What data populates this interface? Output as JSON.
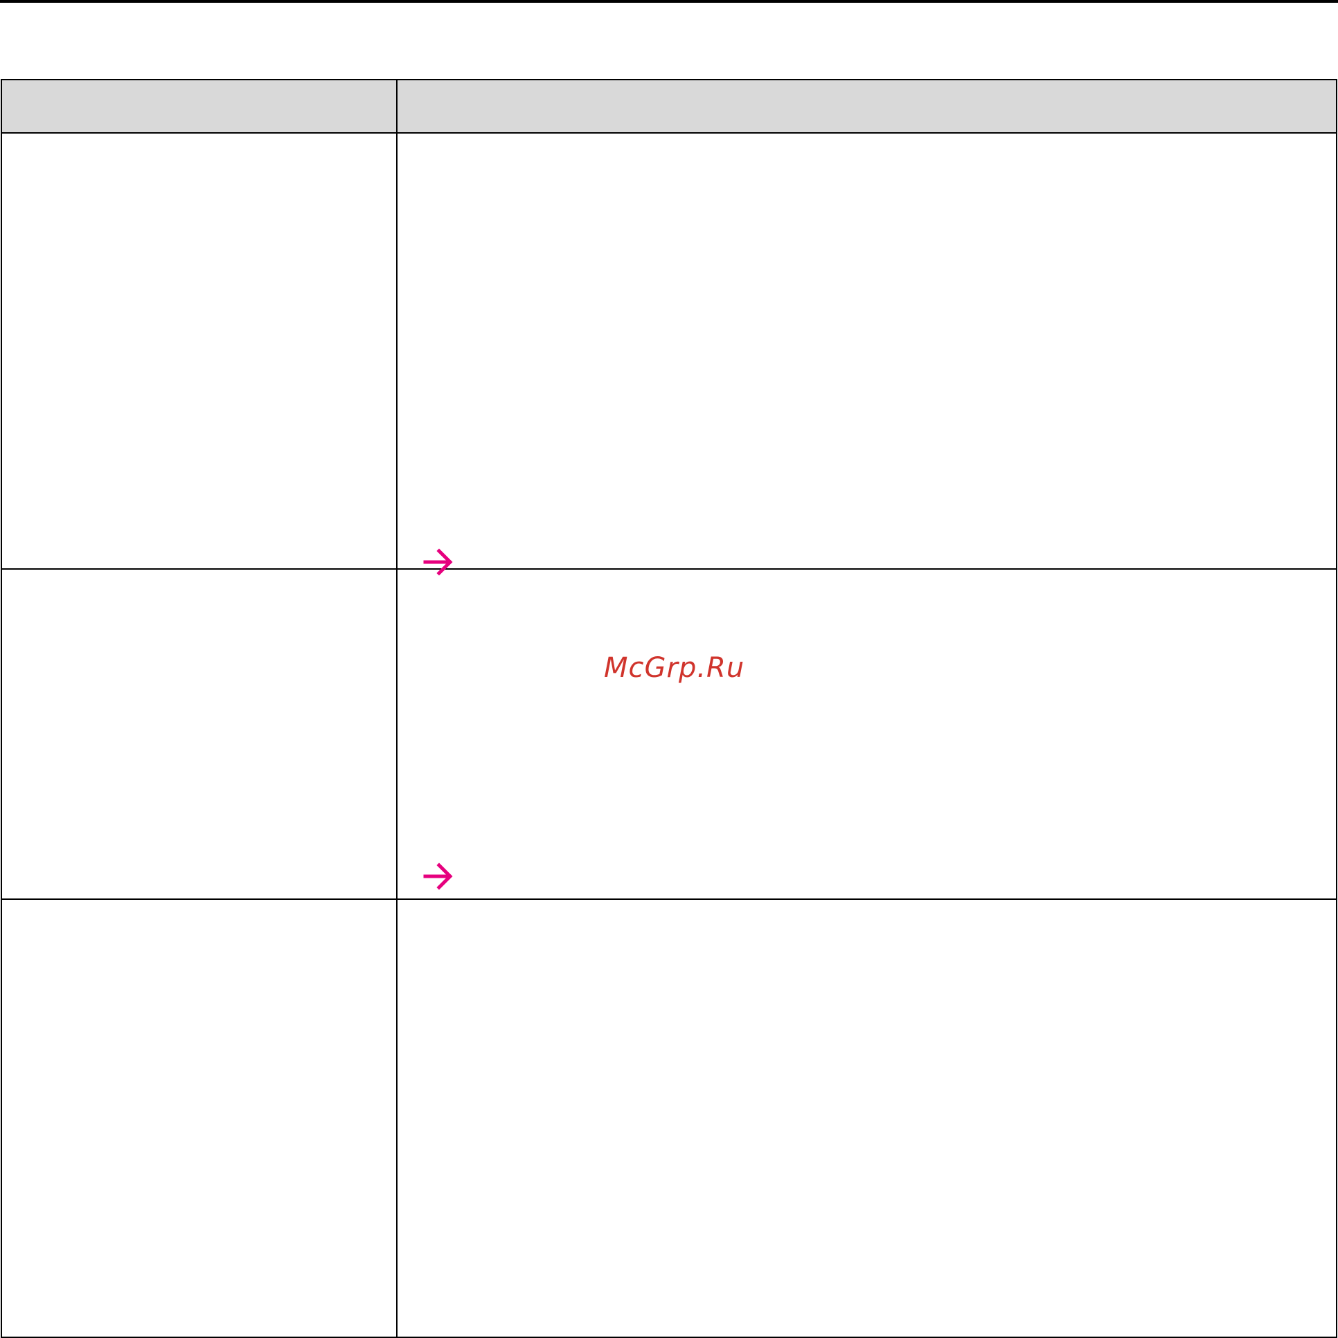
{
  "table": {
    "header": [
      "",
      ""
    ],
    "rows": [
      {
        "left": "",
        "right": ""
      },
      {
        "left": "",
        "right": ""
      },
      {
        "left": "",
        "right": ""
      }
    ]
  },
  "icons": {
    "arrow_icon": "right-arrow-icon",
    "arrow_color": "#e6007e"
  },
  "watermark": {
    "text": "McGrp.Ru",
    "color": "#d0342c"
  }
}
